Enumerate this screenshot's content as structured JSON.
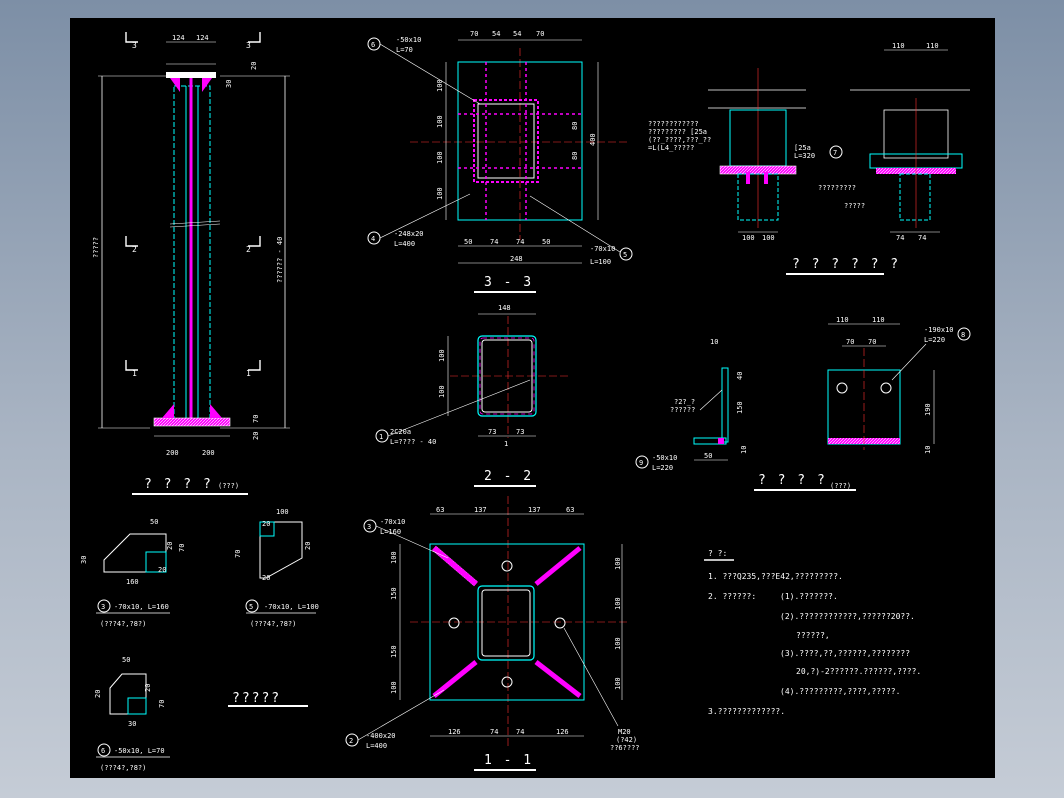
{
  "colors": {
    "sheet": "#000000",
    "outline": "#00ffff",
    "weld": "#ff00ff",
    "center": "#ff3030",
    "text": "#ffffff",
    "bolt": "#ffff00"
  },
  "column": {
    "title": "? ? ? ?",
    "title_sub": "(???)",
    "sec3": "3",
    "sec2": "2",
    "sec1": "1",
    "top_dims": [
      "124",
      "124"
    ],
    "top_h": "20",
    "top_h2": "30",
    "left_label": "?????",
    "right_label": "?????? - 40",
    "base_dims": [
      "200",
      "200"
    ],
    "base_h": "20",
    "base_h2": "70"
  },
  "s33": {
    "title": "3 - 3",
    "top_dims": [
      "70",
      "54",
      "54",
      "70"
    ],
    "left_dims": [
      "100",
      "100",
      "100",
      "100"
    ],
    "right_dims": [
      "80",
      "80"
    ],
    "right_total": "400",
    "bottom_dims": [
      "50",
      "74",
      "74",
      "50"
    ],
    "bottom_total": "248",
    "tag6": "6",
    "tag6_a": "-50x10",
    "tag6_b": "L=70",
    "tag4": "4",
    "tag4_a": "-248x20",
    "tag4_b": "L=400",
    "tag5": "5",
    "tag5_a": "-70x10",
    "tag5_b": "L=100"
  },
  "s22": {
    "title": "2 - 2",
    "top": "148",
    "left_dims": [
      "100",
      "100"
    ],
    "bottom_dims": [
      "73",
      "73"
    ],
    "tag1": "1",
    "tag1_a": "2C20a",
    "tag1_b": "L=???? - 40",
    "cut": "1"
  },
  "s11": {
    "title": "1 - 1",
    "top_dims": [
      "63",
      "137",
      "137",
      "63"
    ],
    "left_dims": [
      "100",
      "150",
      "150",
      "100"
    ],
    "right_dims": [
      "100",
      "100",
      "100",
      "100"
    ],
    "bottom_dims": [
      "126",
      "74",
      "74",
      "126"
    ],
    "tag3": "3",
    "tag3_a": "-70x10",
    "tag3_b": "L=160",
    "tag2": "2",
    "tag2_a": "-400x20",
    "tag2_b": "L=400",
    "note_a": "M20",
    "note_b": "(?42)",
    "note_c": "??6????"
  },
  "node": {
    "title": "? ? ? ? ? ?",
    "lines": [
      "????????????",
      "????????? [25a",
      "(??_????,???_??",
      "=L(L4_?????"
    ],
    "tag7": "7",
    "tag7_a": "[25a",
    "tag7_b": "L=320",
    "top_dims": [
      "110",
      "110"
    ],
    "bottom_dims": [
      "100",
      "100"
    ],
    "bottom_dims2": [
      "74",
      "74"
    ],
    "lbl_a": "?????????",
    "lbl_b": "?????"
  },
  "conn": {
    "title": "? ? ? ?",
    "title_sub": "(???)",
    "left_top": "10",
    "left_dims": [
      "40",
      "150"
    ],
    "left_bot": "10",
    "left_w": "50",
    "note_a": "?2?_?",
    "note_b": "??????",
    "tag9": "9",
    "tag9_a": "-50x10",
    "tag9_b": "L=220",
    "top_dims": [
      "110",
      "110"
    ],
    "inner_dims": [
      "70",
      "70"
    ],
    "tag8": "8",
    "tag8_a": "-190x10",
    "tag8_b": "L=220",
    "right_dim": "190",
    "right_bot": "10"
  },
  "plates": {
    "p3_dims": [
      "50",
      "20",
      "70",
      "160",
      "20",
      "30"
    ],
    "p3_tag": "3",
    "p3_lbl": "-70x10, L=160",
    "p3_sub": "(???4?,?8?)",
    "p5_dims": [
      "100",
      "20",
      "70",
      "20",
      "20"
    ],
    "p5_tag": "5",
    "p5_lbl": "-70x10, L=100",
    "p5_sub": "(???4?,?8?)",
    "p6_dims": [
      "50",
      "20",
      "20",
      "70",
      "30"
    ],
    "p6_tag": "6",
    "p6_lbl": "-50x10, L=70",
    "p6_sub": "(???4?,?8?)",
    "ref": "?????"
  },
  "notes": {
    "title": "? ?:",
    "lines": [
      "1. ???Q235,???E42,?????????.",
      "2. ??????:",
      "(1).???????.",
      "(2).????????????,??????20??.",
      "??????,",
      "(3).????,??,??????,????????",
      "20,?)-2??????.??????,????.",
      "(4).?????????,????,?????.",
      "3.?????????????."
    ]
  }
}
